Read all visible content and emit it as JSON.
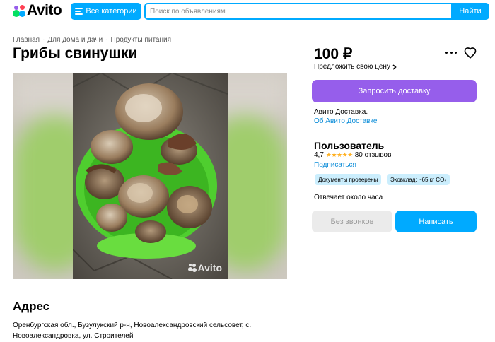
{
  "header": {
    "logo_text": "Avito",
    "categories_label": "Все категории",
    "search_placeholder": "Поиск по объявлениям",
    "search_button": "Найти"
  },
  "breadcrumb": [
    "Главная",
    "Для дома и дачи",
    "Продукты питания"
  ],
  "listing": {
    "title": "Грибы свинушки",
    "watermark": "Avito"
  },
  "sidebar": {
    "price": "100 ₽",
    "offer_price": "Предложить свою цену",
    "delivery_button": "Запросить доставку",
    "avito_delivery": "Авито Доставка.",
    "about_delivery": "Об Авито Доставке",
    "seller": {
      "name": "Пользователь",
      "rating": "4,7",
      "stars": "★★★★★",
      "reviews": "80 отзывов",
      "subscribe": "Подписаться"
    },
    "badges": [
      "Документы проверены",
      "Эковклад: ~65 кг CO₂"
    ],
    "reply_time": "Отвечает около часа",
    "no_calls_button": "Без звонков",
    "write_button": "Написать"
  },
  "address": {
    "title": "Адрес",
    "line1": "Оренбургская обл., Бузулукский р-н, Новоалександровский сельсовет, с.",
    "line2": "Новоалександровка, ул. Строителей"
  },
  "colors": {
    "accent": "#00aaff",
    "delivery": "#965eeb",
    "link": "#0a8cd8",
    "badge": "#cbeefd"
  }
}
